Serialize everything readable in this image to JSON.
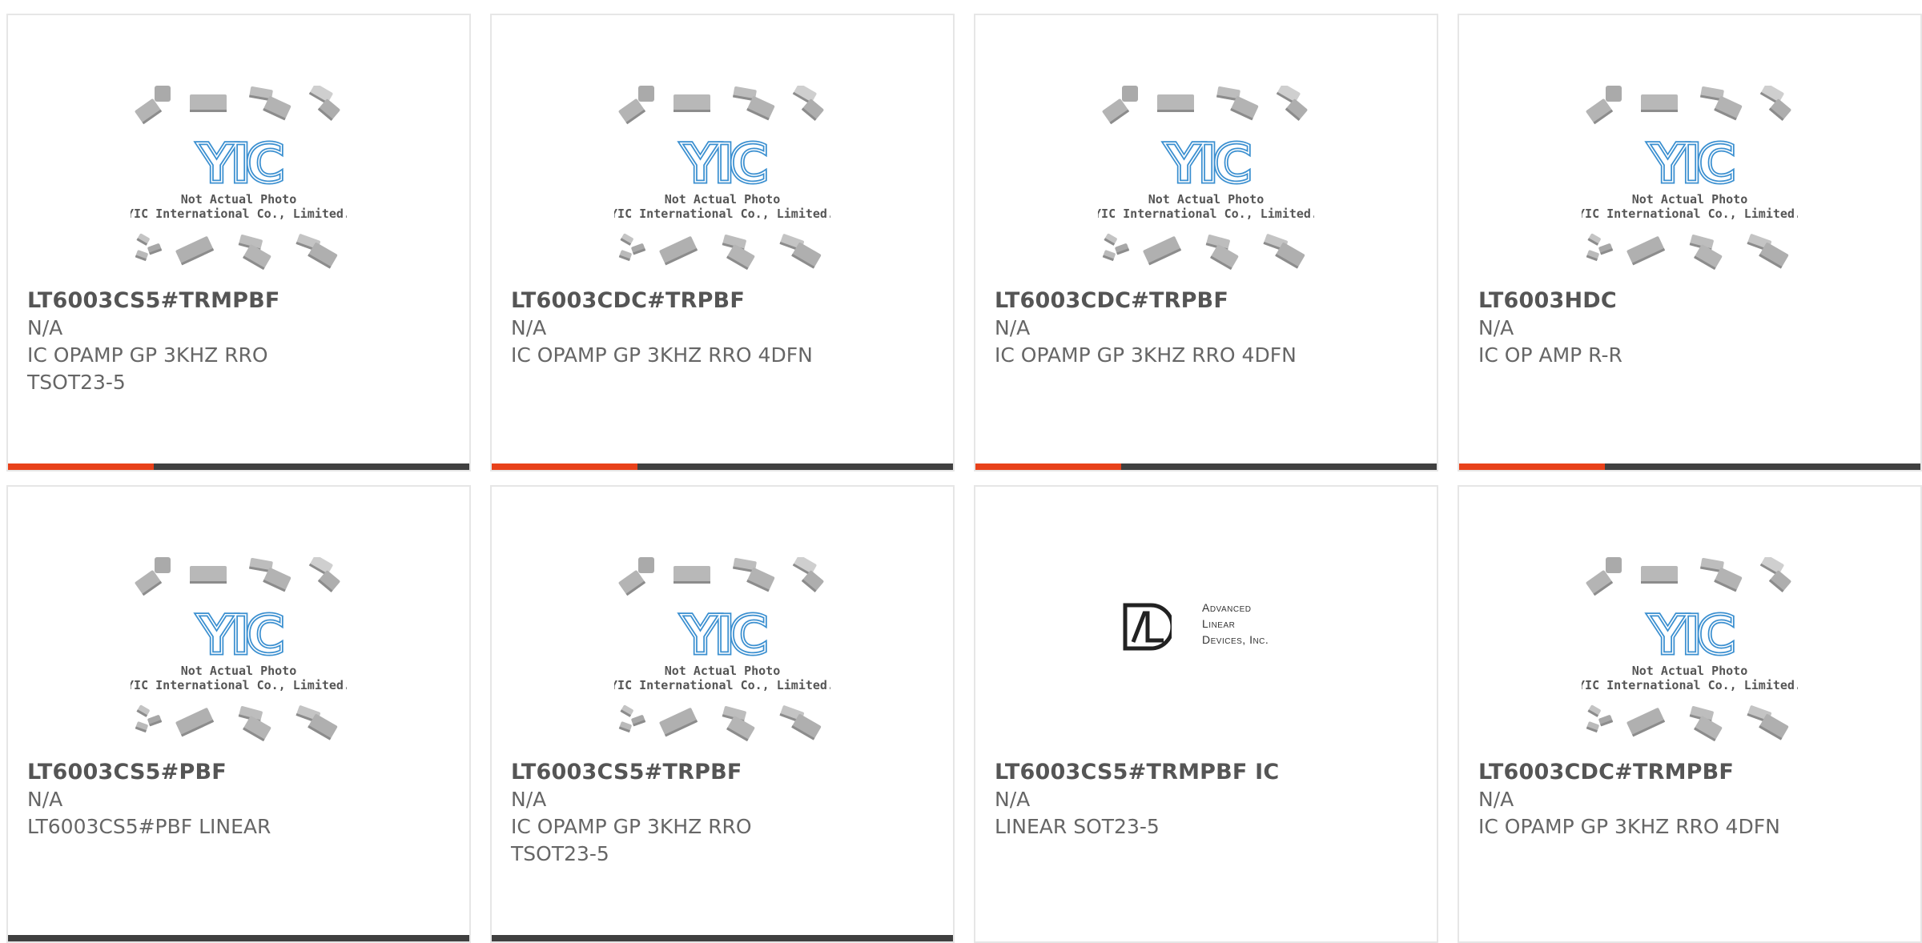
{
  "colors": {
    "accent": "#e8411a",
    "bar": "#404040",
    "part_number": "#555555",
    "text": "#666666"
  },
  "placeholder_image": {
    "caption_line1": "Not Actual Photo",
    "caption_line2": "YIC International Co., Limited.",
    "logo_text": "YIC"
  },
  "adl_logo": {
    "line1": "Advanced",
    "line2": "Linear",
    "line3": "Devices, Inc."
  },
  "products": [
    {
      "part_number": "LT6003CS5#TRMPBF",
      "manufacturer": "N/A",
      "description": "IC OPAMP GP 3KHZ RRO TSOT23-5",
      "image": "yic-placeholder",
      "highlighted": true
    },
    {
      "part_number": "LT6003CDC#TRPBF",
      "manufacturer": "N/A",
      "description": "IC OPAMP GP 3KHZ RRO 4DFN",
      "image": "yic-placeholder",
      "highlighted": true
    },
    {
      "part_number": "LT6003CDC#TRPBF",
      "manufacturer": "N/A",
      "description": "IC OPAMP GP 3KHZ RRO 4DFN",
      "image": "yic-placeholder",
      "highlighted": true
    },
    {
      "part_number": "LT6003HDC",
      "manufacturer": "N/A",
      "description": "IC OP AMP R-R",
      "image": "yic-placeholder",
      "highlighted": true
    },
    {
      "part_number": "LT6003CS5#PBF",
      "manufacturer": "N/A",
      "description": "LT6003CS5#PBF LINEAR",
      "image": "yic-placeholder",
      "highlighted": false
    },
    {
      "part_number": "LT6003CS5#TRPBF",
      "manufacturer": "N/A",
      "description": "IC OPAMP GP 3KHZ RRO TSOT23-5",
      "image": "yic-placeholder",
      "highlighted": false
    },
    {
      "part_number": "LT6003CS5#TRMPBF IC",
      "manufacturer": "N/A",
      "description": "LINEAR SOT23-5",
      "image": "adl-logo",
      "highlighted": false
    },
    {
      "part_number": "LT6003CDC#TRMPBF",
      "manufacturer": "N/A",
      "description": "IC OPAMP GP 3KHZ RRO 4DFN",
      "image": "yic-placeholder",
      "highlighted": false
    }
  ]
}
